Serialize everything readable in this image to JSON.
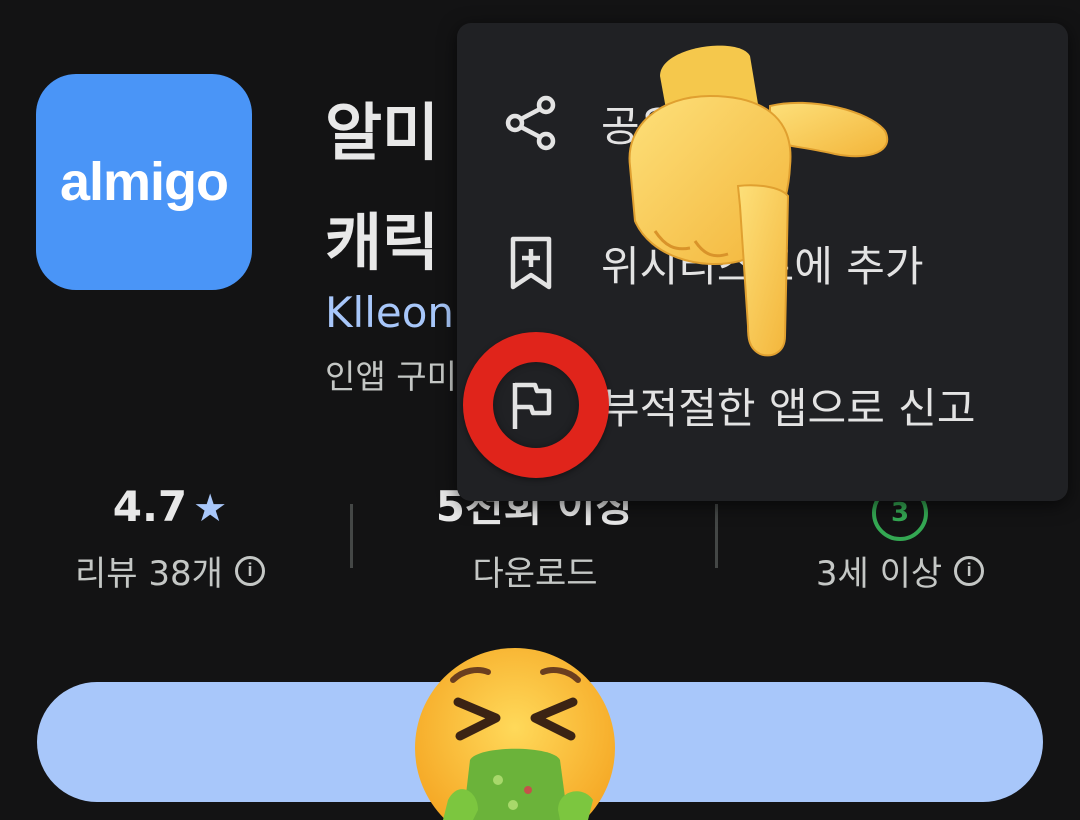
{
  "app": {
    "icon_label": "almigo",
    "title": "알미\n캐릭",
    "developer": "Klleon",
    "in_app_note": "인앱 구미"
  },
  "stats": {
    "rating": "4.7",
    "rating_star": "★",
    "reviews_label": "리뷰 38개",
    "downloads": "5천회 이상",
    "downloads_label": "다운로드",
    "age_badge": "3",
    "age_label": "3세 이상"
  },
  "menu": {
    "items": [
      {
        "label": "공유",
        "icon": "share-icon"
      },
      {
        "label": "위시리스트에 추가",
        "icon": "bookmark-add-icon"
      },
      {
        "label": "부적절한 앱으로 신고",
        "icon": "flag-icon"
      }
    ]
  },
  "overlays": {
    "hand_emoji": "pointing-down-hand",
    "face_emoji": "vomiting-face",
    "highlight_color": "#e0241b"
  },
  "colors": {
    "background": "#131314",
    "accent": "#a8c7fa",
    "icon_bg": "#4a95f7",
    "menu_bg": "#202124",
    "age_green": "#34a853"
  }
}
